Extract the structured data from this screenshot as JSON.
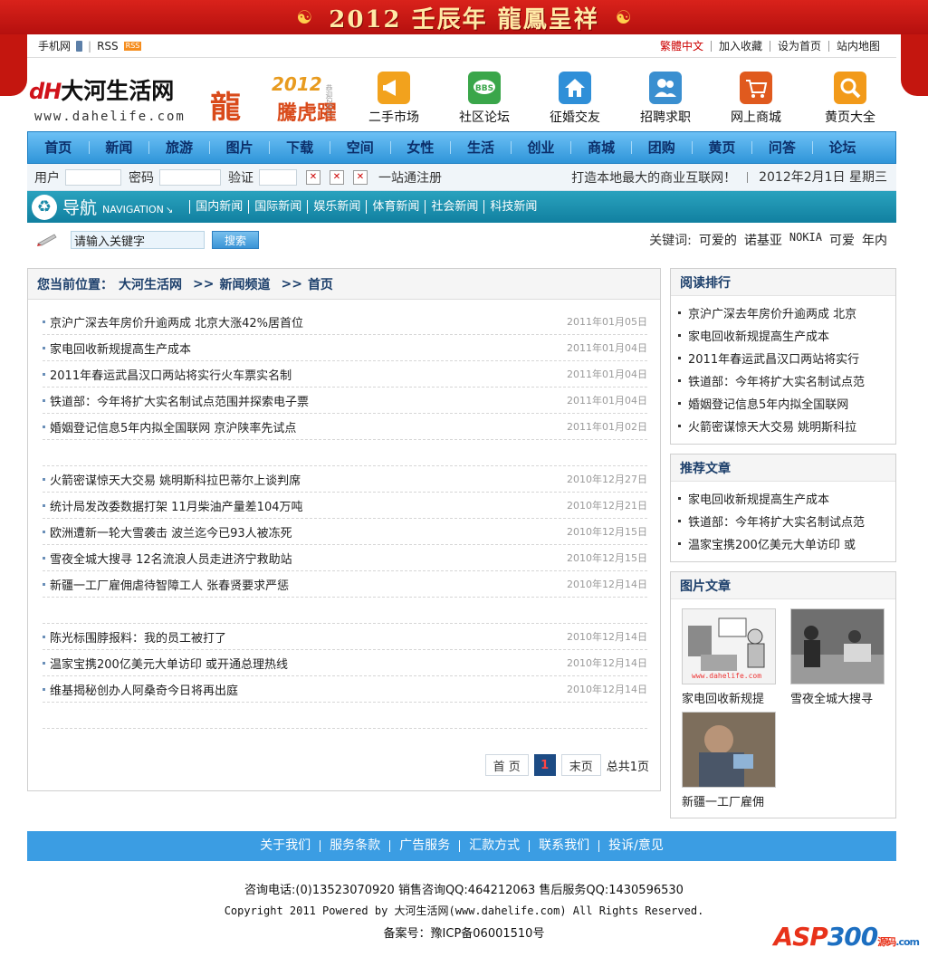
{
  "banner": {
    "title": "2012 壬辰年 龍鳳呈祥"
  },
  "util": {
    "mobile": "手机网",
    "rss": "RSS",
    "rss_badge": "RSS",
    "links": [
      "繁體中文",
      "加入收藏",
      "设为首页",
      "站内地图"
    ]
  },
  "logo": {
    "mark": "dH",
    "name": "大河生活网",
    "url": "www.dahelife.com"
  },
  "festive": {
    "big": "龍",
    "year": "2012",
    "sub": "騰虎躍",
    "small": "恭迎2012"
  },
  "quick_links": [
    {
      "label": "二手市场",
      "icon": "megaphone-icon",
      "color": "#f2a21d"
    },
    {
      "label": "社区论坛",
      "icon": "bbs-icon",
      "color": "#3aa64a"
    },
    {
      "label": "征婚交友",
      "icon": "house-icon",
      "color": "#2f8fd8"
    },
    {
      "label": "招聘求职",
      "icon": "people-icon",
      "color": "#3a8fd0"
    },
    {
      "label": "网上商城",
      "icon": "cart-icon",
      "color": "#e05a1e"
    },
    {
      "label": "黄页大全",
      "icon": "magnifier-icon",
      "color": "#f29a1a"
    }
  ],
  "main_nav": [
    "首页",
    "新闻",
    "旅游",
    "图片",
    "下载",
    "空间",
    "女性",
    "生活",
    "创业",
    "商城",
    "团购",
    "黄页",
    "问答",
    "论坛"
  ],
  "login": {
    "user_label": "用户",
    "password_label": "密码",
    "verify_label": "验证",
    "register": "一站通注册",
    "slogan": "打造本地最大的商业互联网！",
    "date": "2012年2月1日 星期三"
  },
  "sub_nav": {
    "title": "导航",
    "title_en": "NAVIGATION",
    "items": [
      "国内新闻",
      "国际新闻",
      "娱乐新闻",
      "体育新闻",
      "社会新闻",
      "科技新闻"
    ]
  },
  "search": {
    "value": "请输入关键字",
    "button": "搜索",
    "keywords_label": "关键词:",
    "keywords": [
      "可爱的",
      "诺基亚",
      "NOKIA",
      "可爱",
      "年内"
    ]
  },
  "breadcrumb": [
    "您当前位置：",
    "大河生活网",
    ">>",
    "新闻频道",
    ">>",
    "首页"
  ],
  "news_groups": [
    [
      {
        "title": "京沪广深去年房价升逾两成 北京大涨42%居首位",
        "date": "2011年01月05日"
      },
      {
        "title": "家电回收新规提高生产成本",
        "date": "2011年01月04日"
      },
      {
        "title": "2011年春运武昌汉口两站将实行火车票实名制",
        "date": "2011年01月04日"
      },
      {
        "title": "铁道部：今年将扩大实名制试点范围并探索电子票",
        "date": "2011年01月04日"
      },
      {
        "title": "婚姻登记信息5年内拟全国联网 京沪陕率先试点",
        "date": "2011年01月02日"
      }
    ],
    [
      {
        "title": "火箭密谋惊天大交易 姚明斯科拉巴蒂尔上谈判席",
        "date": "2010年12月27日"
      },
      {
        "title": "统计局发改委数据打架 11月柴油产量差104万吨",
        "date": "2010年12月21日"
      },
      {
        "title": "欧洲遭新一轮大雪袭击 波兰迄今已93人被冻死",
        "date": "2010年12月15日"
      },
      {
        "title": "雪夜全城大搜寻 12名流浪人员走进济宁救助站",
        "date": "2010年12月15日"
      },
      {
        "title": "新疆一工厂雇佣虐待智障工人 张春贤要求严惩",
        "date": "2010年12月14日"
      }
    ],
    [
      {
        "title": "陈光标围脖报料：我的员工被打了",
        "date": "2010年12月14日"
      },
      {
        "title": "温家宝携200亿美元大单访印 或开通总理热线",
        "date": "2010年12月14日"
      },
      {
        "title": "维基揭秘创办人阿桑奇今日将再出庭",
        "date": "2010年12月14日"
      }
    ]
  ],
  "pager": {
    "first": "首 页",
    "current": "1",
    "last": "末页",
    "total": "总共1页"
  },
  "reading_rank": {
    "title": "阅读排行",
    "items": [
      "京沪广深去年房价升逾两成 北京",
      "家电回收新规提高生产成本",
      "2011年春运武昌汉口两站将实行",
      "铁道部：今年将扩大实名制试点范",
      "婚姻登记信息5年内拟全国联网",
      "火箭密谋惊天大交易 姚明斯科拉"
    ]
  },
  "recommended": {
    "title": "推荐文章",
    "items": [
      "家电回收新规提高生产成本",
      "铁道部：今年将扩大实名制试点范",
      "温家宝携200亿美元大单访印 或"
    ]
  },
  "photo_articles": {
    "title": "图片文章",
    "items": [
      {
        "caption": "家电回收新规提",
        "img_text": "www.dahelife.com"
      },
      {
        "caption": "雪夜全城大搜寻"
      },
      {
        "caption": "新疆一工厂雇佣"
      }
    ]
  },
  "footer": {
    "links": [
      "关于我们",
      "服务条款",
      "广告服务",
      "汇款方式",
      "联系我们",
      "投诉/意见"
    ],
    "line1": "咨询电话:(0)13523070920 销售咨询QQ:464212063 售后服务QQ:1430596530",
    "line2": "Copyright 2011 Powered by 大河生活网(www.dahelife.com) All Rights Reserved.",
    "line3": "备案号：豫ICP备06001510号"
  },
  "watermark": {
    "a": "ASP",
    "b": "300",
    "c": "源码",
    "d": ".com"
  }
}
